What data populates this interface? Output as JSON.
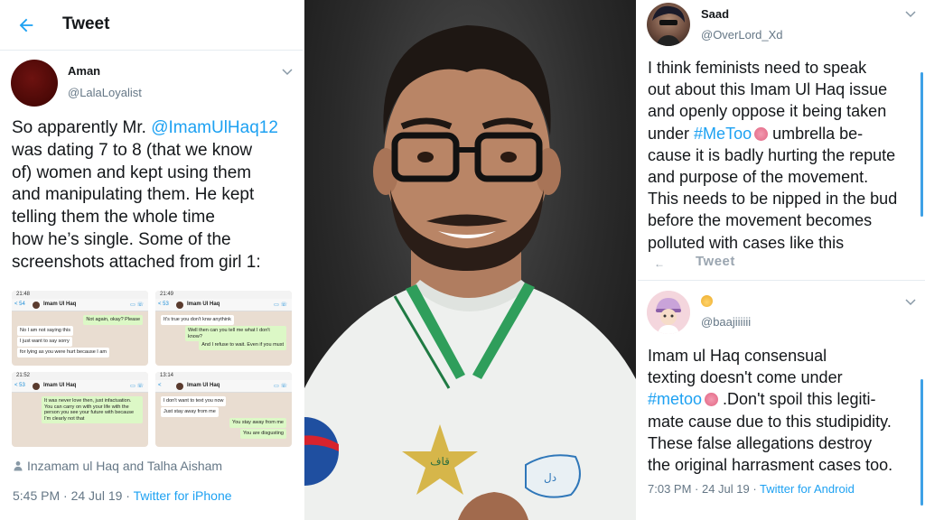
{
  "left_tweet": {
    "header_title": "Tweet",
    "author_name": "Aman",
    "author_handle": "@LalaLoyalist",
    "text_lines": [
      {
        "pre": "So apparently Mr. ",
        "link": "@ImamUlHaq12",
        "post": ""
      },
      {
        "pre": "was dating 7 to 8 (that we know",
        "link": "",
        "post": ""
      },
      {
        "pre": "of) women and kept using them",
        "link": "",
        "post": ""
      },
      {
        "pre": "and manipulating them. He kept",
        "link": "",
        "post": ""
      },
      {
        "pre": "telling them the whole time",
        "link": "",
        "post": ""
      },
      {
        "pre": "how he’s single. Some of the",
        "link": "",
        "post": ""
      },
      {
        "pre": "screenshots attached from girl 1:",
        "link": "",
        "post": ""
      }
    ],
    "screenshots": [
      {
        "time": "21:48",
        "back": "< 54",
        "contact": "Imam Ul Haq",
        "messages": [
          {
            "dir": "out",
            "text": "Not again, okay? Please"
          },
          {
            "dir": "in",
            "text": "No I am not saying this"
          },
          {
            "dir": "in",
            "text": "I just want to say sorry"
          },
          {
            "dir": "in",
            "text": "for lying as you were hurt because I am"
          }
        ]
      },
      {
        "time": "21:49",
        "back": "< 53",
        "contact": "Imam Ul Haq",
        "messages": [
          {
            "dir": "in",
            "text": "It's true you don't knw anythink"
          },
          {
            "dir": "out",
            "text": "Well then can you tell me what I don't know?"
          },
          {
            "dir": "out",
            "text": "And I refuse to wait. Even if you must"
          }
        ]
      },
      {
        "time": "21:52",
        "back": "< 53",
        "contact": "Imam Ul Haq",
        "messages": [
          {
            "dir": "out",
            "text": "It was never love then, just infactuation. You can carry on with your life with the person you see your future with because I'm clearly not that"
          }
        ]
      },
      {
        "time": "13:14",
        "back": "<",
        "contact": "Imam Ul Haq",
        "messages": [
          {
            "dir": "in",
            "text": "I don't want to text you now"
          },
          {
            "dir": "in",
            "text": "Just stay away from me"
          },
          {
            "dir": "out",
            "text": "You stay away from me"
          },
          {
            "dir": "out",
            "text": "You are disgusting"
          }
        ]
      }
    ],
    "tagged_people": "Inzamam ul Haq and Talha Aisham",
    "timestamp": "5:45 PM · 24 Jul 19 · ",
    "source": "Twitter for iPhone"
  },
  "right_tweet_1": {
    "author_name": "Saad",
    "author_handle": "@OverLord_Xd",
    "text_lines": [
      {
        "pre": "I think feminists need to speak",
        "link": "",
        "post": "",
        "emoji": false
      },
      {
        "pre": "out about this Imam Ul Haq issue",
        "link": "",
        "post": "",
        "emoji": false
      },
      {
        "pre": "and openly oppose it being taken",
        "link": "",
        "post": "",
        "emoji": false
      },
      {
        "pre": "under ",
        "link": "#MeToo",
        "post": " umbrella be-",
        "emoji": true
      },
      {
        "pre": "cause it is badly hurting the repute",
        "link": "",
        "post": "",
        "emoji": false
      },
      {
        "pre": "and purpose of the movement.",
        "link": "",
        "post": "",
        "emoji": false
      },
      {
        "pre": "This needs to be nipped in the bud",
        "link": "",
        "post": "",
        "emoji": false
      },
      {
        "pre": "before the movement becomes",
        "link": "",
        "post": "",
        "emoji": false
      },
      {
        "pre": "polluted with cases like this",
        "link": "",
        "post": "",
        "emoji": false
      }
    ],
    "ghost_header": "Tweet"
  },
  "right_tweet_2": {
    "author_handle": "@baajiiiiii",
    "text_lines": [
      {
        "pre": "Imam ul Haq consensual",
        "link": "",
        "post": "",
        "emoji": false
      },
      {
        "pre": "texting doesn't come under",
        "link": "",
        "post": "",
        "emoji": false
      },
      {
        "pre": "",
        "link": "#metoo",
        "post": " .Don't spoil this legiti-",
        "emoji": true
      },
      {
        "pre": "mate cause due to this studipidity.",
        "link": "",
        "post": "",
        "emoji": false
      },
      {
        "pre": "These false allegations destroy",
        "link": "",
        "post": "",
        "emoji": false
      },
      {
        "pre": "the original harrasment cases too.",
        "link": "",
        "post": "",
        "emoji": false
      }
    ],
    "timestamp": "7:03 PM · 24 Jul 19 · ",
    "source": "Twitter for Android"
  },
  "photo": {
    "jersey_logo_text": "قاف"
  },
  "colors": {
    "link_blue": "#1da1f2",
    "muted_gray": "#657786",
    "accent_scroll": "#3ea1e6"
  }
}
